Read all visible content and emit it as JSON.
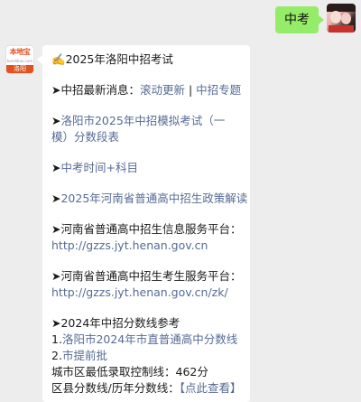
{
  "outgoing": {
    "text": "中考"
  },
  "incoming": {
    "avatar": {
      "logo_top": "本地宝",
      "logo_sub": "bendibao.com",
      "city": "洛阳"
    },
    "title_icon": "✍️",
    "title": "2025年洛阳中招考试",
    "news_prefix": "➤中招最新消息：",
    "news_link1": "滚动更新",
    "news_sep": " | ",
    "news_link2": "中招专题",
    "mock_link_prefix": "➤",
    "mock_link": "洛阳市2025年中招模拟考试（一模）分数段表",
    "time_prefix": "➤",
    "time_link": "中考时间+科目",
    "policy_prefix": "➤",
    "policy_link": "2025年河南省普通高中招生政策解读",
    "info_platform_label": "➤河南省普通高中招生信息服务平台：",
    "info_platform_url": "http://gzzs.jyt.henan.gov.cn",
    "exam_platform_label": "➤河南省普通高中招生考生服务平台：",
    "exam_platform_url": "http://gzzs.jyt.henan.gov.cn/zk/",
    "scores_title": "➤2024年中招分数线参考",
    "score1_num": "1.",
    "score1_link": "洛阳市2024年市直普通高中分数线",
    "score2_num": "2.",
    "score2_link": "市提前批",
    "city_min_label": "城市区最低录取控制线：",
    "city_min_value": "462分",
    "county_label": "区县分数线/历年分数线：",
    "county_link": "【点此查看】"
  }
}
